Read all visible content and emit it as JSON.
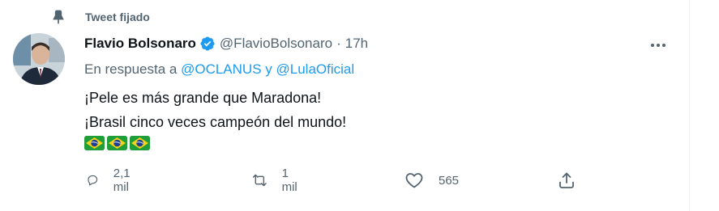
{
  "pinned": {
    "label": "Tweet fijado",
    "icon": "pin-icon"
  },
  "author": {
    "display_name": "Flavio Bolsonaro",
    "handle": "@FlavioBolsonaro",
    "separator": "·",
    "time": "17h",
    "verified_icon": "verified-badge-icon"
  },
  "reply": {
    "prefix": "En respuesta a",
    "mention1": "@OCLANUS",
    "conjunction": "y",
    "mention2": "@LulaOficial"
  },
  "text": {
    "line1": "¡Pele es más grande que Maradona!",
    "line2": "¡Brasil cinco veces campeón del mundo!",
    "emoji": [
      "brazil-flag",
      "brazil-flag",
      "brazil-flag"
    ]
  },
  "actions": {
    "reply_count": "2,1 mil",
    "retweet_count": "1 mil",
    "like_count": "565"
  },
  "colors": {
    "text": "#0f1419",
    "secondary": "#536471",
    "link": "#1d9bf0",
    "border": "#eff3f4"
  }
}
